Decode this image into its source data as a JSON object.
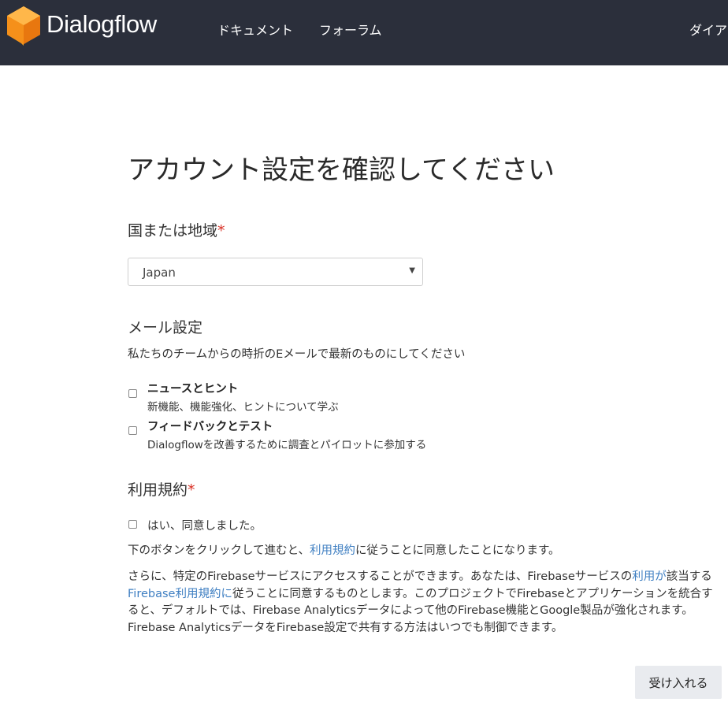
{
  "header": {
    "brand": "Dialogflow",
    "nav": [
      "ドキュメント",
      "フォーラム"
    ],
    "nav_truncated": "ダイア"
  },
  "title": "アカウント設定を確認してください",
  "region": {
    "label": "国または地域",
    "required_mark": "*",
    "selected": "Japan"
  },
  "email": {
    "label": "メール設定",
    "description": "私たちのチームからの時折のEメールで最新のものにしてください",
    "options": [
      {
        "title": "ニュースとヒント",
        "subtitle": "新機能、機能強化、ヒントについて学ぶ"
      },
      {
        "title": "フィードバックとテスト",
        "subtitle": "Dialogflowを改善するために調査とパイロットに参加する"
      }
    ]
  },
  "terms": {
    "label": "利用規約",
    "required_mark": "*",
    "agree": "はい、同意しました。",
    "notice_before": "下のボタンをクリックして進むと、",
    "notice_link": "利用規約",
    "notice_after": "に従うことに同意したことになります。",
    "firebase_1": "さらに、特定のFirebaseサービスにアクセスすることができます。あなたは、Firebaseサービスの",
    "firebase_link1": "利用が",
    "firebase_2": "該当する",
    "firebase_link2": "Firebase利用規約に",
    "firebase_3": "従うことに同意するものとします。このプロジェクトでFirebaseとアプリケーションを統合すると、デフォルトでは、Firebase Analyticsデータによって他のFirebase機能とGoogle製品が強化されます。Firebase AnalyticsデータをFirebase設定で共有する方法はいつでも制御できます。"
  },
  "accept_button": "受け入れる"
}
